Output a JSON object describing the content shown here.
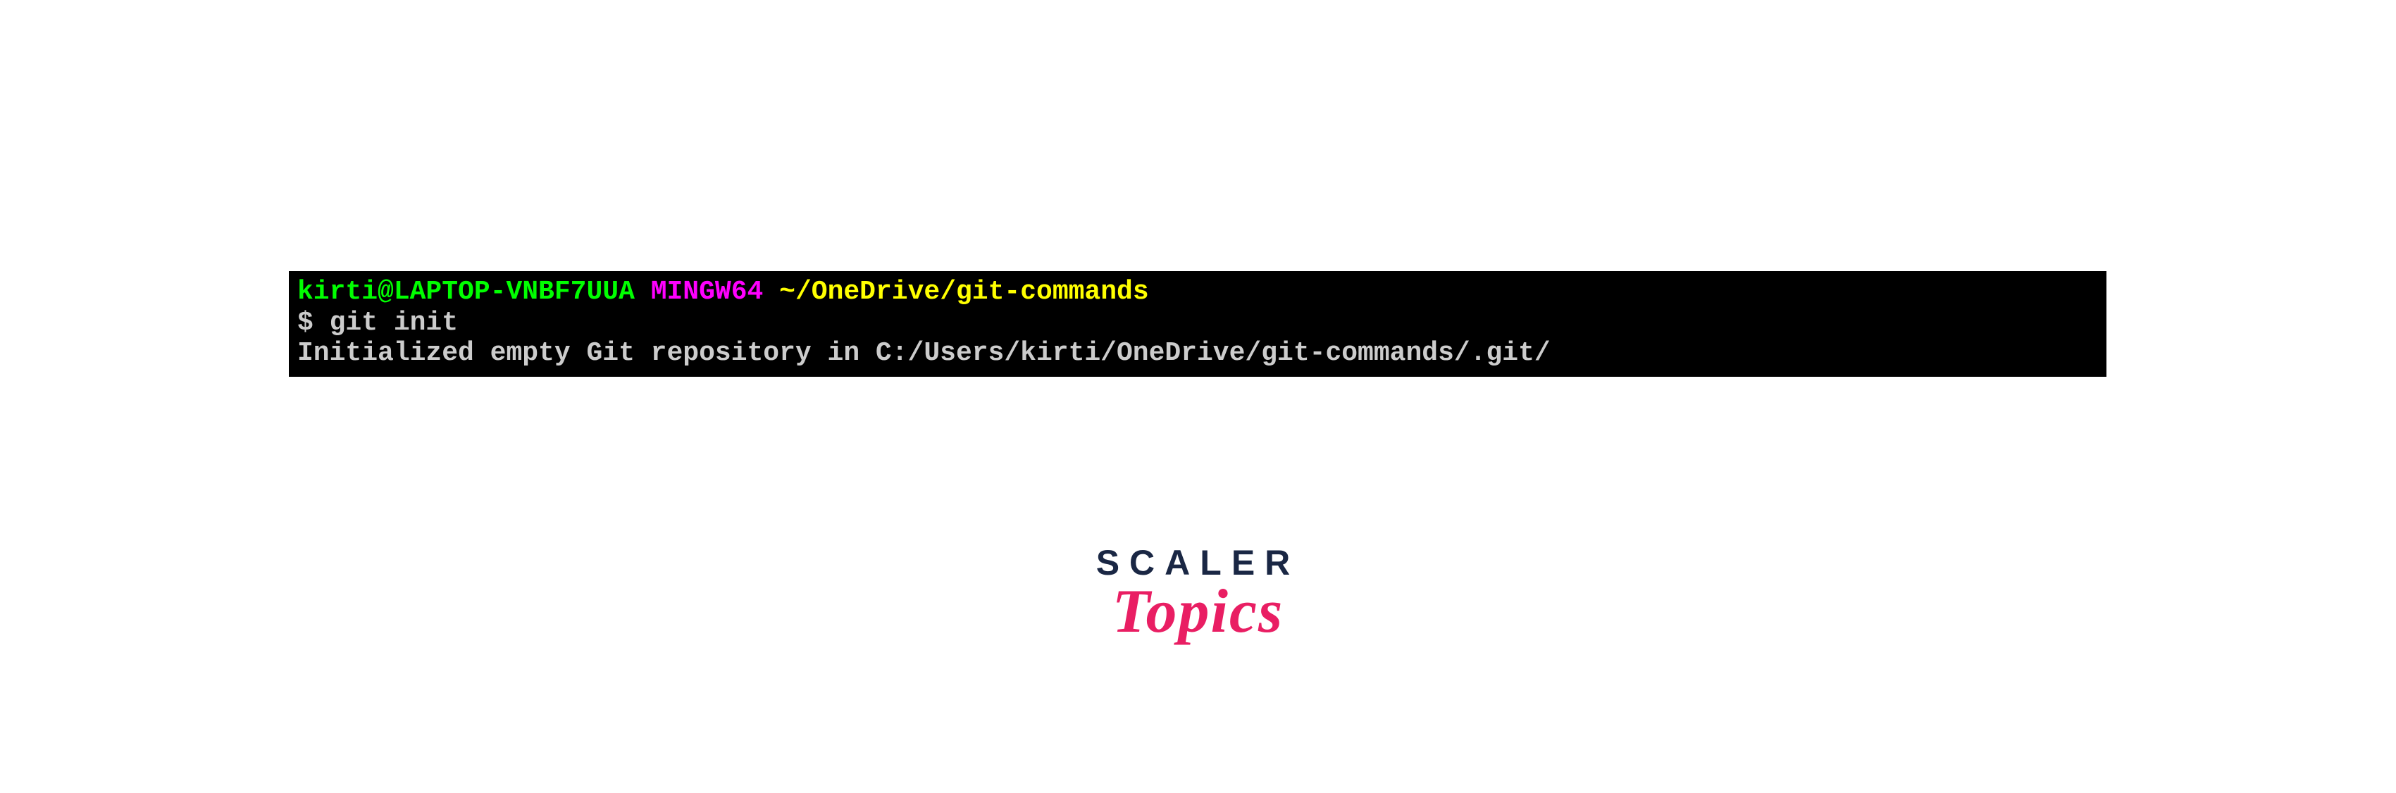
{
  "terminal": {
    "prompt": {
      "user_host": "kirti@LAPTOP-VNBF7UUA",
      "shell": "MINGW64",
      "path": "~/OneDrive/git-commands"
    },
    "command": "$ git init",
    "output": "Initialized empty Git repository in C:/Users/kirti/OneDrive/git-commands/.git/"
  },
  "logo": {
    "line1": "SCALER",
    "line2": "Topics"
  }
}
